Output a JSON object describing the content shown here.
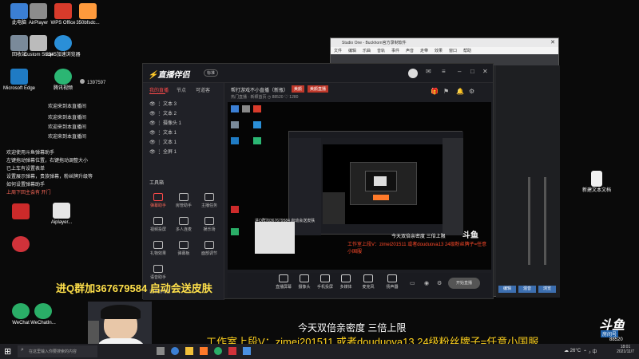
{
  "desktop": {
    "icons": [
      {
        "label": "此电脑"
      },
      {
        "label": "AirPlayer"
      },
      {
        "label": "WPS Office"
      },
      {
        "label": "350bfsdc..."
      },
      {
        "label": "回收站"
      },
      {
        "label": "Custom Shop"
      },
      {
        "label": "2345加速浏览器"
      },
      {
        "label": "Microsoft Edge"
      },
      {
        "label": "Edge浏览器"
      },
      {
        "label": "腾讯视频"
      },
      {
        "label": "Aiplayer..."
      },
      {
        "label": "新建文本文档"
      },
      {
        "label": "WeChat"
      },
      {
        "label": "WeChatIn..."
      }
    ]
  },
  "chat": {
    "lines": [
      "欢迎来到本直播间",
      "欢迎来到本直播间",
      "欢迎来到本直播间",
      "欢迎来到本直播间",
      "欢迎使用斗鱼弹幕助手",
      "左键拖动弹幕位置，右键拖动调整大小",
      "已上车有设置表单",
      "设置展示弹幕，贵族弹幕，粉丝牌升级等",
      "如何设置弹幕助手",
      "上周下回主会有 开门"
    ],
    "viewer_count": "1397597"
  },
  "zhibo": {
    "title": "直播伴侣",
    "version_badge": "标准",
    "tabs": [
      "我的直播",
      "节点",
      "可道客"
    ],
    "room_title": "帮打游戏不小直播（新瓶）",
    "room_tag": "美颜",
    "room_sub": "热门直播 · 新颖首页",
    "room_id": "88520",
    "room_fans": "1280",
    "scenes": [
      "文本 3",
      "文本 2",
      "摄像头 1",
      "文本 1",
      "文本 1",
      "全屏 1"
    ],
    "tools_label": "工具箱",
    "tools": [
      {
        "label": "弹幕助手"
      },
      {
        "label": "房管助手"
      },
      {
        "label": "主播任务"
      },
      {
        "label": "视频投屏"
      },
      {
        "label": "多人连麦"
      },
      {
        "label": "娱乐场"
      },
      {
        "label": "礼物效果"
      },
      {
        "label": "弹幕板"
      },
      {
        "label": "面部调节"
      },
      {
        "label": "语音助手"
      }
    ],
    "more_label": "新增功能",
    "bottom": [
      {
        "label": "直播屏幕"
      },
      {
        "label": "摄像头"
      },
      {
        "label": "手机投屏"
      },
      {
        "label": "多媒体"
      },
      {
        "label": "麦克风"
      },
      {
        "label": "扬声器"
      }
    ],
    "start_button": "开始直播"
  },
  "studio": {
    "title": "Studio One - Buckhorn官方录制软件",
    "menu": [
      "文件",
      "编辑",
      "乐曲",
      "音轨",
      "事件",
      "声音",
      "走带",
      "效果",
      "窗口",
      "帮助",
      "Studio One",
      "Buckhorn官方录制软件"
    ],
    "new_doc": "新建文本文档",
    "bottom_buttons": [
      "编辑",
      "混音",
      "浏览"
    ]
  },
  "overlay": {
    "group_line": "进Q群加367679584 启动会送皮肤",
    "line1": "今天双倍亲密度 三倍上限",
    "line2": "工作室上段V：zimei201511 或者douduova13   24级粉丝牌子=任意小国服",
    "watermark": "斗鱼",
    "watermark_sub": "房间号",
    "room_no": "88520"
  },
  "taskbar": {
    "search_placeholder": "在这里输入你要搜索的内容",
    "weather": "26°C",
    "time": "18:01",
    "date": "2021/11/7"
  }
}
